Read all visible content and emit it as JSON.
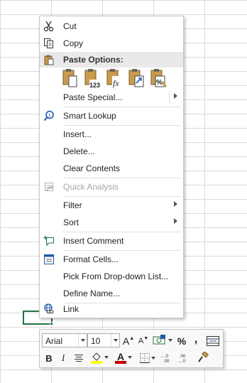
{
  "context_menu": {
    "cut": "Cut",
    "copy": "Copy",
    "paste_options": "Paste Options:",
    "paste_buttons": [
      "Paste",
      "Values",
      "Formulas",
      "Transpose",
      "Formatting"
    ],
    "paste_special": "Paste Special...",
    "smart_lookup": "Smart Lookup",
    "insert": "Insert...",
    "delete": "Delete...",
    "clear_contents": "Clear Contents",
    "quick_analysis": "Quick Analysis",
    "filter": "Filter",
    "sort": "Sort",
    "insert_comment": "Insert Comment",
    "format_cells": "Format Cells...",
    "pick_dropdown": "Pick From Drop-down List...",
    "define_name": "Define Name...",
    "link": "Link"
  },
  "mini_toolbar": {
    "font_name": "Arial",
    "font_size": "10",
    "grow_font": "A",
    "shrink_font": "A",
    "percent": "%",
    "comma": ",",
    "bold": "B",
    "italic": "I",
    "font_color_letter": "A",
    "increase_decimal": "←.0 .00",
    "decrease_decimal": ".00 →.0"
  },
  "colors": {
    "accent_green": "#217346",
    "highlight_yellow": "#ffff00",
    "font_red": "#c00000",
    "icon_blue": "#1e5aa8",
    "clipboard_tan": "#c89b4e"
  }
}
